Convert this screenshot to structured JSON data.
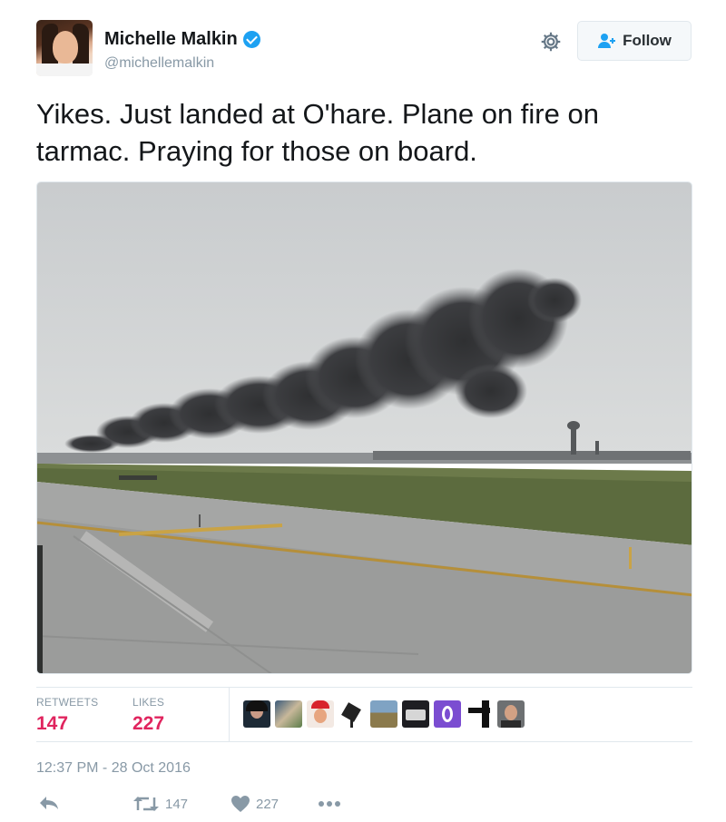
{
  "author": {
    "name": "Michelle Malkin",
    "handle": "@michellemalkin",
    "verified": true
  },
  "header": {
    "follow_label": "Follow",
    "settings_icon": "gear-icon",
    "follow_icon": "follow-user-icon"
  },
  "tweet": {
    "text": "Yikes. Just landed at O'hare. Plane on fire on tarmac. Praying for those on board."
  },
  "stats": {
    "retweets_label": "RETWEETS",
    "retweets_value": "147",
    "likes_label": "LIKES",
    "likes_value": "227"
  },
  "liker_avatars": 10,
  "timestamp": "12:37 PM - 28 Oct 2016",
  "actions": {
    "reply_icon": "reply-icon",
    "retweet_icon": "retweet-icon",
    "retweet_count": "147",
    "like_icon": "heart-icon",
    "like_count": "227",
    "more_icon": "more-icon"
  },
  "colors": {
    "accent": "#1da1f2",
    "stat_value": "#e0245e",
    "muted": "#8899a6",
    "text": "#14171a"
  }
}
